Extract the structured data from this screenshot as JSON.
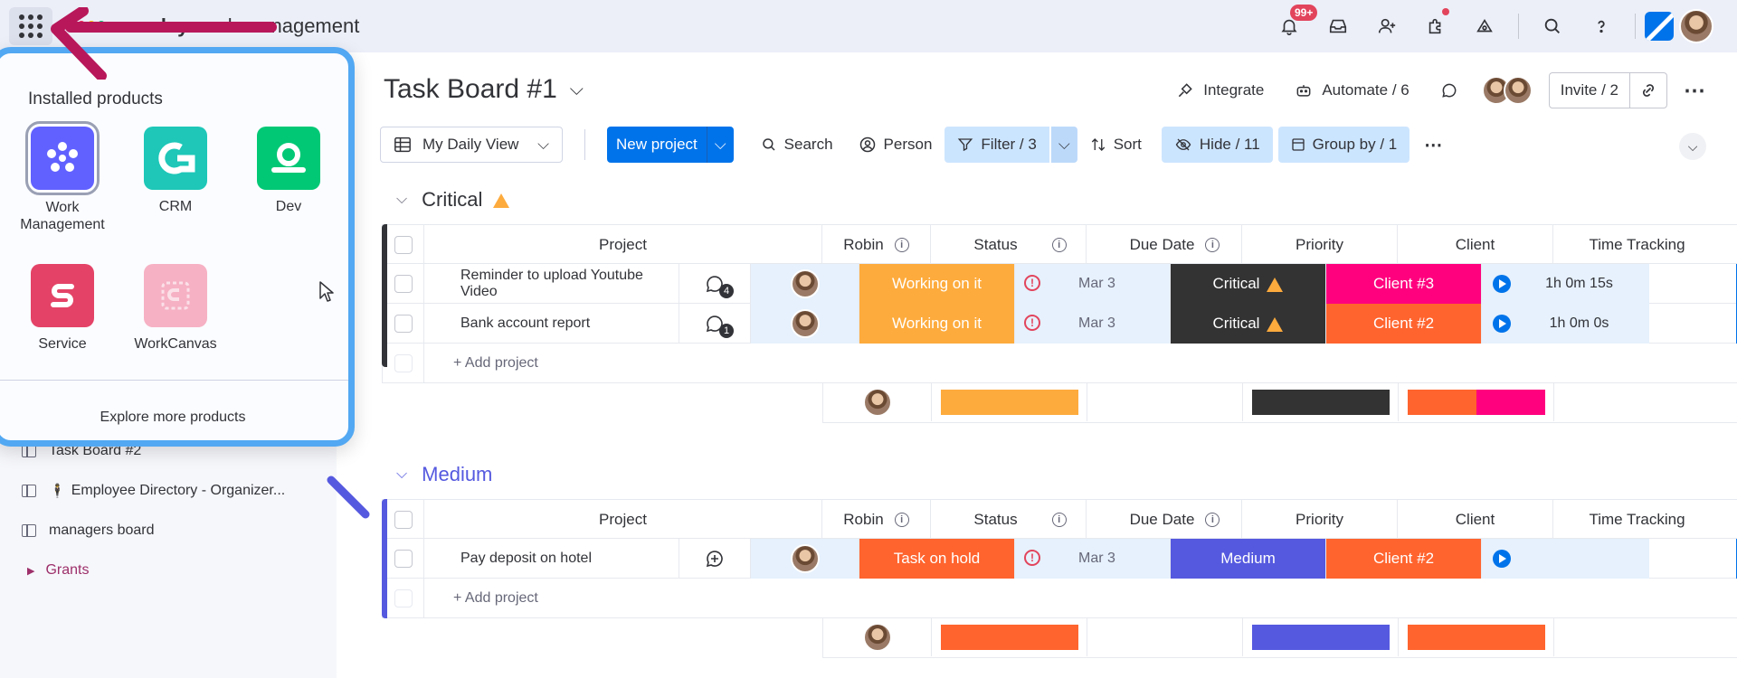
{
  "topbar": {
    "brand_bold": "monday",
    "brand_rest": "work management",
    "notif_badge": "99+",
    "icons": [
      "bell-icon",
      "inbox-icon",
      "invite-user-icon",
      "apps-icon",
      "integrations-icon",
      "search-icon",
      "help-icon"
    ]
  },
  "popup": {
    "title": "Installed products",
    "products": [
      {
        "label": "Work\nManagement",
        "color": "#6161ff",
        "icon": "work-management-icon"
      },
      {
        "label": "CRM",
        "color": "#1ec7b8",
        "icon": "crm-icon"
      },
      {
        "label": "Dev",
        "color": "#00c875",
        "icon": "dev-icon"
      },
      {
        "label": "Service",
        "color": "#e44367",
        "icon": "service-icon"
      },
      {
        "label": "WorkCanvas",
        "color": "#f6b1c4",
        "icon": "workcanvas-icon"
      }
    ],
    "explore": "Explore more products"
  },
  "sidebar": {
    "items": [
      {
        "label": "Task Board #2"
      },
      {
        "label": "Employee Directory - Organizer..."
      },
      {
        "label": "managers board"
      },
      {
        "label": "Grants"
      }
    ]
  },
  "board": {
    "title": "Task Board #1",
    "integrate": "Integrate",
    "automate": "Automate / 6",
    "invite": "Invite / 2"
  },
  "toolbar": {
    "view": "My Daily View",
    "new_project": "New project",
    "search": "Search",
    "person": "Person",
    "filter": "Filter / 3",
    "sort": "Sort",
    "hide": "Hide / 11",
    "group_by": "Group by / 1"
  },
  "columns": {
    "project": "Project",
    "robin": "Robin",
    "status": "Status",
    "due": "Due Date",
    "priority": "Priority",
    "client": "Client",
    "time": "Time Tracking"
  },
  "groups": [
    {
      "name": "Critical",
      "color": "#323338",
      "rows": [
        {
          "project": "Reminder to upload Youtube Video",
          "updates": "4",
          "status": "Working on it",
          "status_color": "#fdab3d",
          "due": "Mar 3",
          "priority": "Critical",
          "priority_color": "#333333",
          "client": "Client #3",
          "client_color": "#ff007f",
          "time": "1h 0m 15s"
        },
        {
          "project": "Bank account report",
          "updates": "1",
          "status": "Working on it",
          "status_color": "#fdab3d",
          "due": "Mar 3",
          "priority": "Critical",
          "priority_color": "#333333",
          "client": "Client #2",
          "client_color": "#ff642e",
          "time": "1h 0m 0s"
        }
      ],
      "add": "+ Add project",
      "summary": {
        "status": [
          "#fdab3d"
        ],
        "priority": [
          "#333333"
        ],
        "client": [
          "#ff642e",
          "#ff007f"
        ]
      }
    },
    {
      "name": "Medium",
      "color": "#5559df",
      "rows": [
        {
          "project": "Pay deposit on hotel",
          "updates": "",
          "status": "Task on hold",
          "status_color": "#ff642e",
          "due": "Mar 3",
          "priority": "Medium",
          "priority_color": "#5559df",
          "client": "Client #2",
          "client_color": "#ff642e",
          "time": ""
        }
      ],
      "add": "+ Add project",
      "summary": {
        "status": [
          "#ff642e"
        ],
        "priority": [
          "#5559df"
        ],
        "client": [
          "#ff642e"
        ]
      }
    }
  ]
}
